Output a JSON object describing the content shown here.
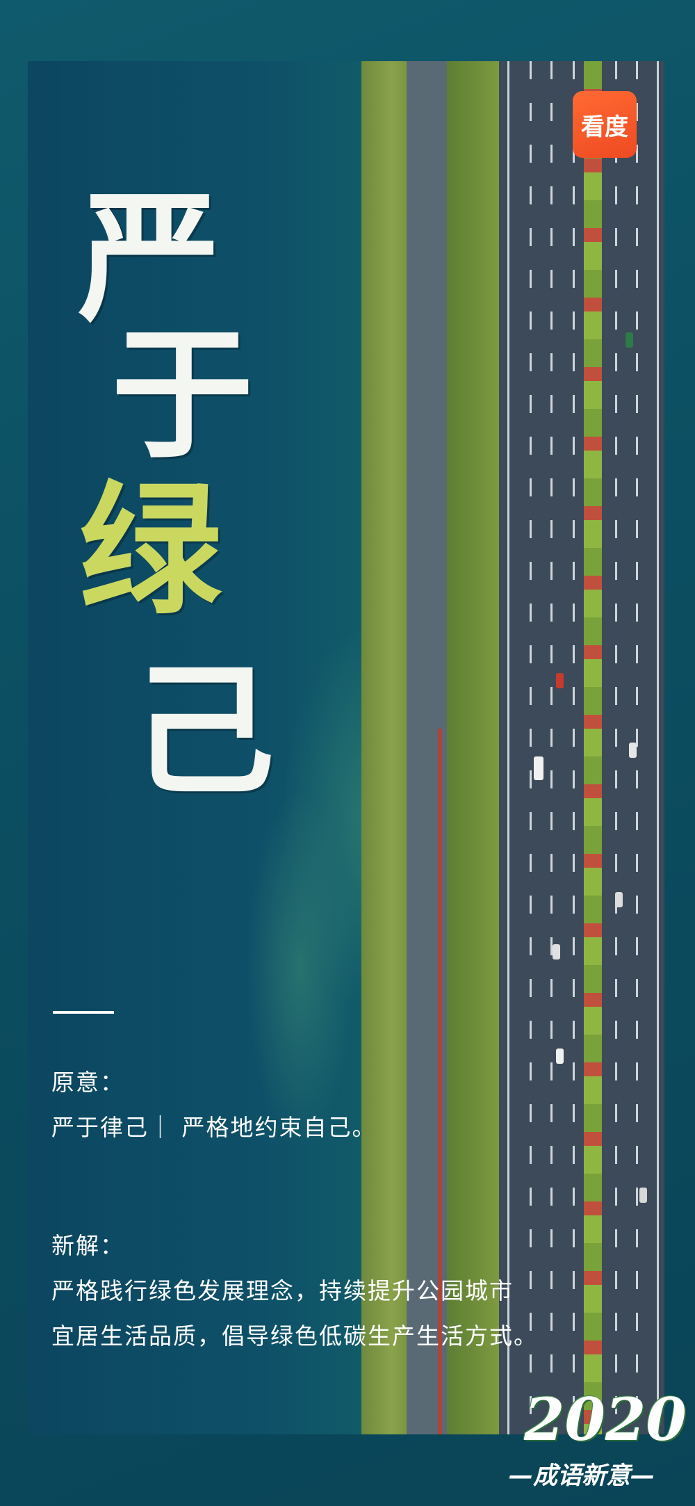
{
  "title_chars": [
    "严",
    "于",
    "绿",
    "己"
  ],
  "logo_text": "看度",
  "meaning": {
    "label": "原意：",
    "text": "严于律己｜ 严格地约束自己。"
  },
  "new_meaning": {
    "label": "新解：",
    "line1": "严格践行绿色发展理念，持续提升公园城市",
    "line2": "宜居生活品质，倡导绿色低碳生产生活方式。"
  },
  "year": "2020",
  "tagline": "—成语新意—",
  "colors": {
    "accent_green": "#cbd860",
    "logo_orange": "#f05527",
    "sea": "#0c4f62"
  }
}
